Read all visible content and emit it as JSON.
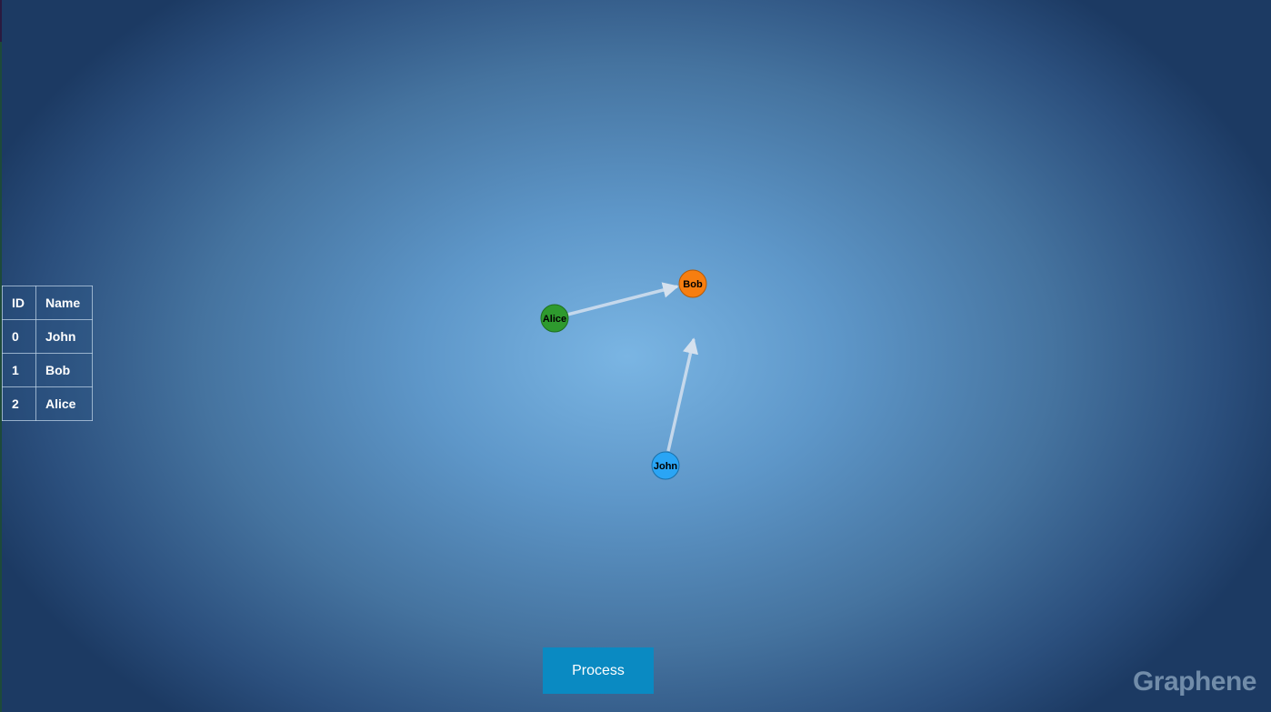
{
  "table": {
    "headers": {
      "id": "ID",
      "name": "Name"
    },
    "rows": [
      {
        "id": "0",
        "name": "John"
      },
      {
        "id": "1",
        "name": "Bob"
      },
      {
        "id": "2",
        "name": "Alice"
      }
    ]
  },
  "graph": {
    "nodes": [
      {
        "key": "john",
        "label": "John",
        "color": "#2aa5f5"
      },
      {
        "key": "bob",
        "label": "Bob",
        "color": "#f77e10"
      },
      {
        "key": "alice",
        "label": "Alice",
        "color": "#2e9a2e"
      }
    ],
    "edges": [
      {
        "from": "Alice",
        "to": "Bob"
      },
      {
        "from": "John",
        "to": "Bob"
      }
    ],
    "edge_color": "#d5e1ee"
  },
  "actions": {
    "process_label": "Process"
  },
  "brand": {
    "logo_text": "Graphene"
  }
}
